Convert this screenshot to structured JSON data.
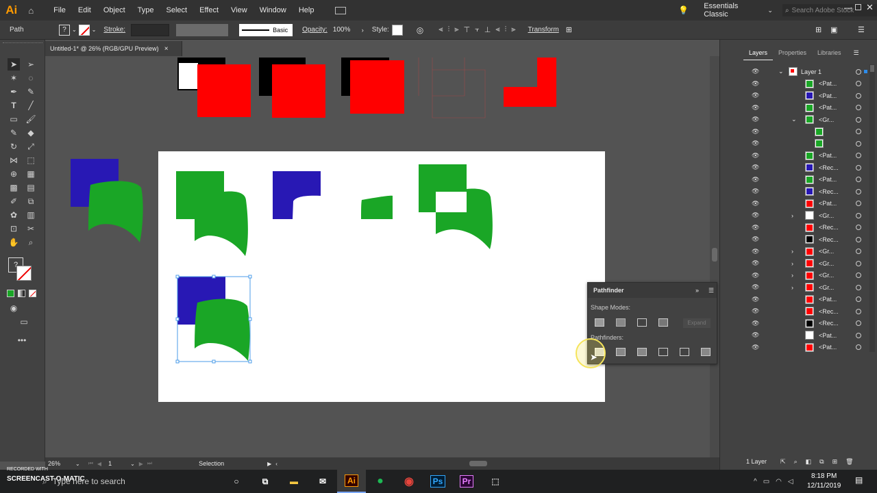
{
  "app": {
    "logo": "Ai",
    "workspace": "Essentials Classic",
    "search_placeholder": "Search Adobe Stock"
  },
  "menu": [
    "File",
    "Edit",
    "Object",
    "Type",
    "Select",
    "Effect",
    "View",
    "Window",
    "Help"
  ],
  "control_bar": {
    "selection_type": "Path",
    "stroke_label": "Stroke:",
    "brush_label": "Basic",
    "opacity_label": "Opacity:",
    "opacity_value": "100%",
    "style_label": "Style:",
    "transform_label": "Transform"
  },
  "document": {
    "tab_title": "Untitled-1* @ 26% (RGB/GPU Preview)",
    "close": "×"
  },
  "status": {
    "zoom": "26%",
    "artboard": "1",
    "tool": "Selection"
  },
  "pathfinder": {
    "title": "Pathfinder",
    "shape_modes_label": "Shape Modes:",
    "expand_label": "Expand",
    "pathfinders_label": "Pathfinders:"
  },
  "layers_panel": {
    "tabs": [
      "Layers",
      "Properties",
      "Libraries"
    ],
    "layer_name": "Layer 1",
    "items": [
      {
        "name": "<Pat...",
        "color": "#1aa626",
        "indent": 0
      },
      {
        "name": "<Pat...",
        "color": "#2818b4",
        "indent": 0
      },
      {
        "name": "<Pat...",
        "color": "#1aa626",
        "indent": 0
      },
      {
        "name": "<Gr...",
        "color": "#1aa626",
        "indent": 0,
        "expanded": true
      },
      {
        "name": "",
        "color": "#1aa626",
        "indent": 1
      },
      {
        "name": "",
        "color": "#1aa626",
        "indent": 1
      },
      {
        "name": "<Pat...",
        "color": "#1aa626",
        "indent": 0
      },
      {
        "name": "<Rec...",
        "color": "#2818b4",
        "indent": 0
      },
      {
        "name": "<Pat...",
        "color": "#1aa626",
        "indent": 0
      },
      {
        "name": "<Rec...",
        "color": "#2818b4",
        "indent": 0
      },
      {
        "name": "<Pat...",
        "color": "#ff0000",
        "indent": 0
      },
      {
        "name": "<Gr...",
        "color": "#ffffff",
        "indent": 0,
        "collapsed": true
      },
      {
        "name": "<Rec...",
        "color": "#ff0000",
        "indent": 0
      },
      {
        "name": "<Rec...",
        "color": "#000000",
        "indent": 0
      },
      {
        "name": "<Gr...",
        "color": "#ff0000",
        "indent": 0,
        "collapsed": true
      },
      {
        "name": "<Gr...",
        "color": "#ff0000",
        "indent": 0,
        "collapsed": true
      },
      {
        "name": "<Gr...",
        "color": "#ff0000",
        "indent": 0,
        "collapsed": true
      },
      {
        "name": "<Gr...",
        "color": "#ff0000",
        "indent": 0,
        "collapsed": true
      },
      {
        "name": "<Pat...",
        "color": "#ff0000",
        "indent": 0
      },
      {
        "name": "<Rec...",
        "color": "#ff0000",
        "indent": 0
      },
      {
        "name": "<Rec...",
        "color": "#000000",
        "indent": 0
      },
      {
        "name": "<Pat...",
        "color": "#ffffff",
        "indent": 0
      },
      {
        "name": "<Pat...",
        "color": "#ff0000",
        "indent": 0
      }
    ],
    "footer": "1 Layer"
  },
  "taskbar": {
    "recorded_with": "RECORDED WITH",
    "brand": "SCREENCAST-O-MATIC",
    "search_text": "Type here to search",
    "time": "8:18 PM",
    "date": "12/11/2019",
    "apps": [
      "Ai",
      "Ps",
      "Pr"
    ]
  },
  "colors": {
    "green": "#1aa626",
    "blue": "#2818b4",
    "red": "#ff0000",
    "accent": "#2d8ceb"
  }
}
